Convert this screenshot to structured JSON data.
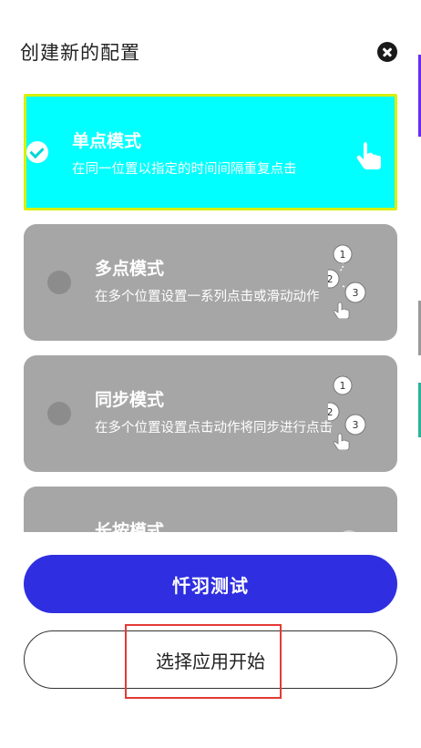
{
  "dialog": {
    "title": "创建新的配置",
    "close_icon": "close-circle-icon"
  },
  "modes": [
    {
      "title": "单点模式",
      "description": "在同一位置以指定的时间间隔重复点击",
      "selected": true,
      "icon": "single-tap-hand-icon"
    },
    {
      "title": "多点模式",
      "description": "在多个位置设置一系列点击或滑动动作",
      "selected": false,
      "icon": "multi-point-sequence-icon",
      "badges": [
        "1",
        "2",
        "3"
      ]
    },
    {
      "title": "同步模式",
      "description": "在多个位置设置点击动作将同步进行点击",
      "selected": false,
      "icon": "sync-points-icon",
      "badges": [
        "1",
        "2",
        "3"
      ]
    },
    {
      "title": "长按模式",
      "description": "",
      "selected": false,
      "icon": "long-press-icon"
    }
  ],
  "buttons": {
    "primary_label": "忏羽测试",
    "secondary_label": "选择应用开始"
  },
  "colors": {
    "selected_card": "#00ffff",
    "selected_border": "#d7f00c",
    "card_gray": "#a6a6a6",
    "primary_button": "#2f2ee0",
    "annotation_red": "#e53935"
  }
}
